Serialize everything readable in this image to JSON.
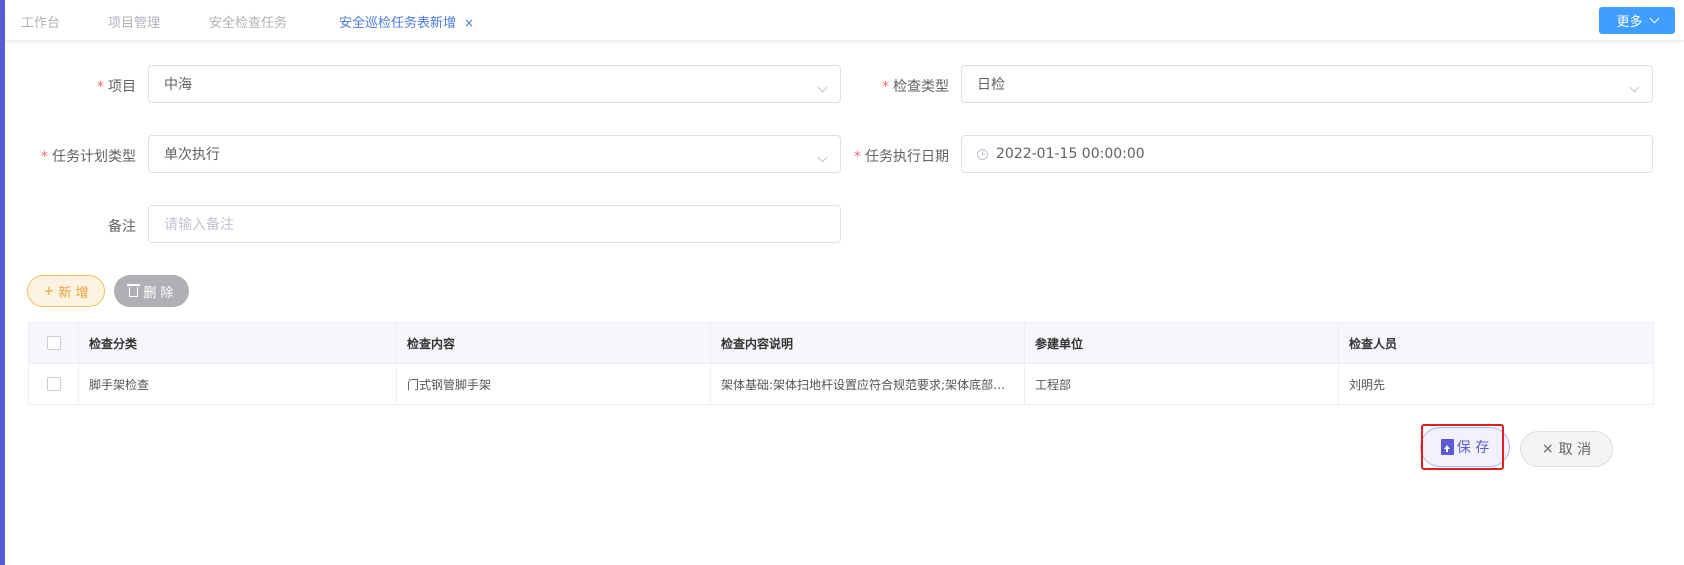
{
  "tabs": [
    {
      "label": "工作台",
      "active": false
    },
    {
      "label": "项目管理",
      "active": false
    },
    {
      "label": "安全检查任务",
      "active": false
    },
    {
      "label": "安全巡检任务表新增",
      "active": true,
      "close": "×"
    }
  ],
  "header": {
    "more_label": "更多"
  },
  "form": {
    "project": {
      "label": "项目",
      "value": "中海"
    },
    "check_type": {
      "label": "检查类型",
      "value": "日检"
    },
    "plan_type": {
      "label": "任务计划类型",
      "value": "单次执行"
    },
    "exec_date": {
      "label": "任务执行日期",
      "value": "2022-01-15 00:00:00"
    },
    "remark": {
      "label": "备注",
      "value": "",
      "placeholder": "请输入备注"
    },
    "required_mark": "*"
  },
  "actions": {
    "add_label": "新 增",
    "add_icon": "+",
    "delete_label": "删 除"
  },
  "table": {
    "columns": [
      "检查分类",
      "检查内容",
      "检查内容说明",
      "参建单位",
      "检查人员"
    ],
    "rows": [
      {
        "category": "脚手架检查",
        "content": "门式钢管脚手架",
        "description": "架体基础:架体扫地杆设置应符合规范要求;架体底部设置垫板和底座应符合规范要求",
        "unit": "工程部",
        "inspector": "刘明先"
      }
    ]
  },
  "footer": {
    "save_label": "保 存",
    "cancel_label": "取 消",
    "cancel_icon": "×"
  },
  "colors": {
    "accent": "#409eff",
    "save": "#5b5bd6",
    "required": "#f56c6c",
    "add": "#e6a23c",
    "highlight": "#e02020"
  }
}
